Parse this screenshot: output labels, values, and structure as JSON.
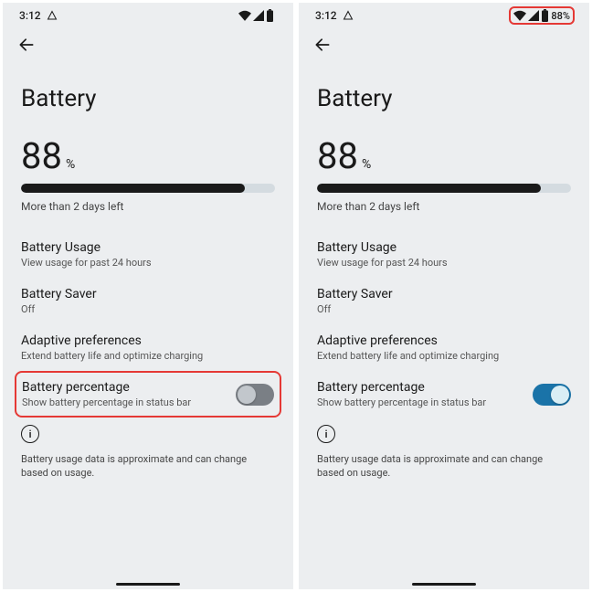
{
  "left": {
    "time": "3:12",
    "status_percent": "",
    "highlight_status": false,
    "title": "Battery",
    "percent_value": "88",
    "percent_symbol": "%",
    "bar_percent": 88,
    "estimate": "More than 2 days left",
    "battery_usage": {
      "label": "Battery Usage",
      "desc": "View usage for past 24 hours"
    },
    "battery_saver": {
      "label": "Battery Saver",
      "desc": "Off"
    },
    "adaptive": {
      "label": "Adaptive preferences",
      "desc": "Extend battery life and optimize charging"
    },
    "percentage": {
      "label": "Battery percentage",
      "desc": "Show battery percentage in status bar",
      "on": false,
      "highlight": true
    },
    "footnote": "Battery usage data is approximate and can change based on usage."
  },
  "right": {
    "time": "3:12",
    "status_percent": "88%",
    "highlight_status": true,
    "title": "Battery",
    "percent_value": "88",
    "percent_symbol": "%",
    "bar_percent": 88,
    "estimate": "More than 2 days left",
    "battery_usage": {
      "label": "Battery Usage",
      "desc": "View usage for past 24 hours"
    },
    "battery_saver": {
      "label": "Battery Saver",
      "desc": "Off"
    },
    "adaptive": {
      "label": "Adaptive preferences",
      "desc": "Extend battery life and optimize charging"
    },
    "percentage": {
      "label": "Battery percentage",
      "desc": "Show battery percentage in status bar",
      "on": true,
      "highlight": false
    },
    "footnote": "Battery usage data is approximate and can change based on usage."
  }
}
